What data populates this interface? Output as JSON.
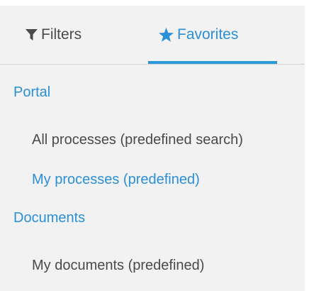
{
  "tabs": {
    "filters": {
      "label": "Filters",
      "icon": "filter-icon"
    },
    "favorites": {
      "label": "Favorites",
      "icon": "star-icon",
      "active": true
    }
  },
  "sections": [
    {
      "title": "Portal",
      "items": [
        {
          "label": "All processes (predefined search)"
        },
        {
          "label": "My processes (predefined)",
          "highlighted": true
        }
      ]
    },
    {
      "title": "Documents",
      "items": [
        {
          "label": "My documents (predefined)"
        }
      ]
    }
  ],
  "colors": {
    "accent": "#2b8fd6",
    "text": "#4a4a4a",
    "panel_bg": "#f2f2f2"
  }
}
